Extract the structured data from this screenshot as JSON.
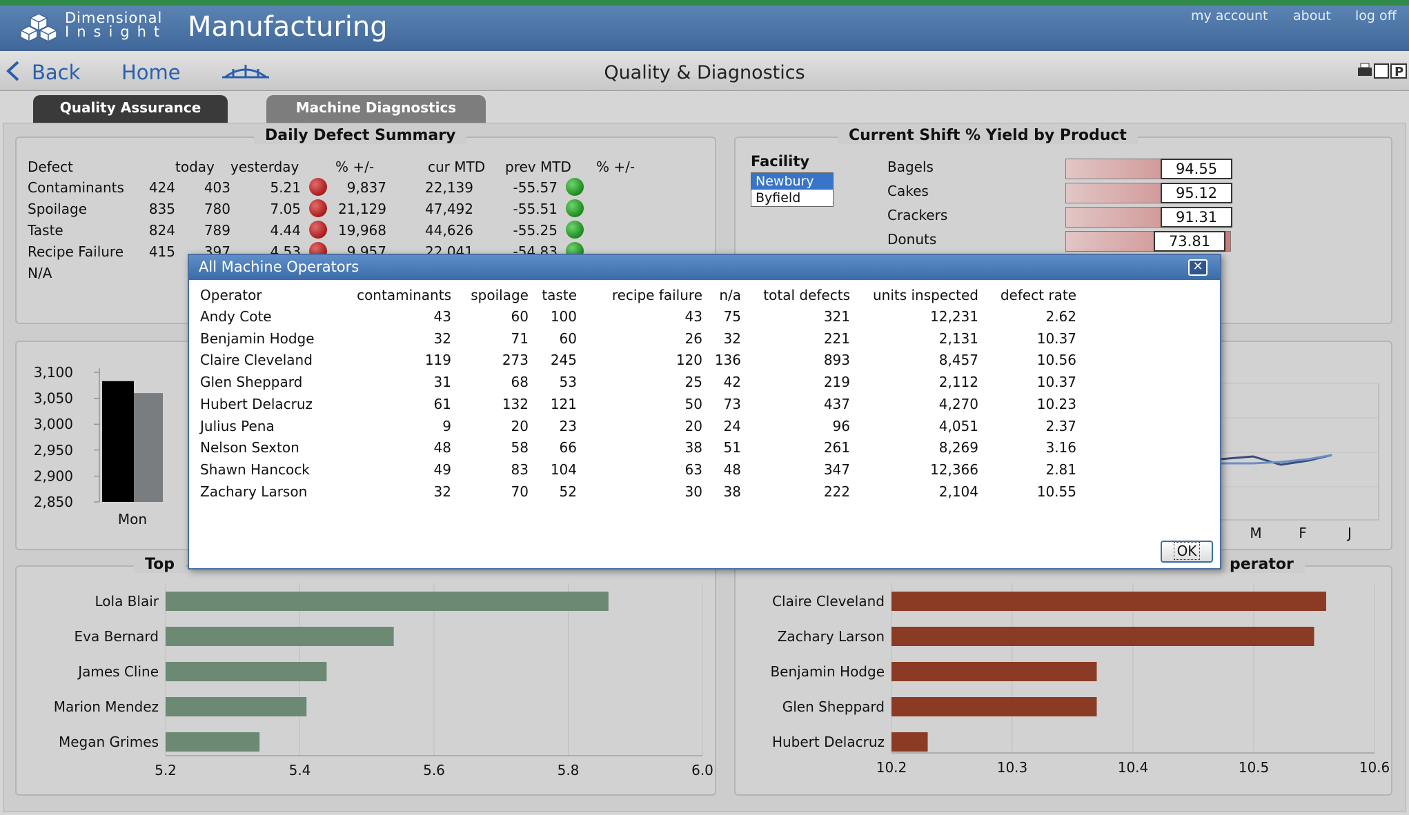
{
  "header": {
    "logo_line1": "Dimensional",
    "logo_line2": "Insight",
    "app_title": "Manufacturing",
    "links": [
      "my account",
      "about",
      "log off"
    ]
  },
  "nav": {
    "back": "Back",
    "home": "Home",
    "page_title": "Quality & Diagnostics"
  },
  "tabs": [
    "Quality Assurance",
    "Machine Diagnostics"
  ],
  "defect_summary": {
    "title": "Daily Defect Summary",
    "columns": [
      "Defect",
      "today",
      "yesterday",
      "% +/-",
      "cur MTD",
      "prev MTD",
      "% +/-"
    ],
    "rows": [
      {
        "name": "Contaminants",
        "today": "424",
        "yesterday": "403",
        "pct": "5.21",
        "cur_mtd": "9,837",
        "prev_mtd": "22,139",
        "pct2": "-55.57"
      },
      {
        "name": "Spoilage",
        "today": "835",
        "yesterday": "780",
        "pct": "7.05",
        "cur_mtd": "21,129",
        "prev_mtd": "47,492",
        "pct2": "-55.51"
      },
      {
        "name": "Taste",
        "today": "824",
        "yesterday": "789",
        "pct": "4.44",
        "cur_mtd": "19,968",
        "prev_mtd": "44,626",
        "pct2": "-55.25"
      },
      {
        "name": "Recipe Failure",
        "today": "415",
        "yesterday": "397",
        "pct": "4.53",
        "cur_mtd": "9,957",
        "prev_mtd": "22,041",
        "pct2": "-54.83"
      },
      {
        "name": "N/A",
        "today": "",
        "yesterday": "",
        "pct": "",
        "cur_mtd": "",
        "prev_mtd": "",
        "pct2": ""
      }
    ]
  },
  "yield": {
    "title": "Current Shift % Yield by Product",
    "facility_label": "Facility",
    "facilities": [
      "Newbury",
      "Byfield"
    ],
    "selected_facility": "Newbury",
    "products": [
      {
        "name": "Bagels",
        "value": "94.55"
      },
      {
        "name": "Cakes",
        "value": "95.12"
      },
      {
        "name": "Crackers",
        "value": "91.31"
      },
      {
        "name": "Donuts",
        "value": "73.81"
      }
    ]
  },
  "daily_chart": {
    "category": "Mon",
    "ticks": [
      "3,100",
      "3,050",
      "3,000",
      "2,950",
      "2,900",
      "2,850"
    ]
  },
  "trend_chart": {
    "month_ticks": [
      "M",
      "F",
      "J"
    ]
  },
  "left_bar_title": "Top",
  "right_bar_title": "perator",
  "chart_data": [
    {
      "type": "bar",
      "title": "Top",
      "orientation": "horizontal",
      "categories": [
        "Lola Blair",
        "Eva Bernard",
        "James Cline",
        "Marion Mendez",
        "Megan Grimes"
      ],
      "values": [
        5.86,
        5.54,
        5.44,
        5.41,
        5.34
      ],
      "xlim": [
        5.2,
        6.0
      ],
      "ticks": [
        "5.2",
        "5.4",
        "5.6",
        "5.8",
        "6.0"
      ],
      "color": "#6c8a73",
      "grid": true
    },
    {
      "type": "bar",
      "title": "perator",
      "orientation": "horizontal",
      "categories": [
        "Claire Cleveland",
        "Zachary Larson",
        "Benjamin Hodge",
        "Glen Sheppard",
        "Hubert Delacruz"
      ],
      "values": [
        10.56,
        10.55,
        10.37,
        10.37,
        10.23
      ],
      "xlim": [
        10.2,
        10.6
      ],
      "ticks": [
        "10.2",
        "10.3",
        "10.4",
        "10.5",
        "10.6"
      ],
      "color": "#8b3a24",
      "grid": true
    },
    {
      "type": "bar",
      "categories": [
        "Mon"
      ],
      "series": [
        {
          "values": [
            3083
          ]
        },
        {
          "values": [
            3060
          ]
        }
      ],
      "ylim": [
        2850,
        3100
      ],
      "colors": [
        "#000000",
        "#7a7d80"
      ]
    }
  ],
  "modal": {
    "title": "All Machine Operators",
    "columns": [
      "Operator",
      "contaminants",
      "spoilage",
      "taste",
      "recipe failure",
      "n/a",
      "total defects",
      "units inspected",
      "defect rate"
    ],
    "rows": [
      [
        "Andy Cote",
        "43",
        "60",
        "100",
        "43",
        "75",
        "321",
        "12,231",
        "2.62"
      ],
      [
        "Benjamin Hodge",
        "32",
        "71",
        "60",
        "26",
        "32",
        "221",
        "2,131",
        "10.37"
      ],
      [
        "Claire Cleveland",
        "119",
        "273",
        "245",
        "120",
        "136",
        "893",
        "8,457",
        "10.56"
      ],
      [
        "Glen Sheppard",
        "31",
        "68",
        "53",
        "25",
        "42",
        "219",
        "2,112",
        "10.37"
      ],
      [
        "Hubert Delacruz",
        "61",
        "132",
        "121",
        "50",
        "73",
        "437",
        "4,270",
        "10.23"
      ],
      [
        "Julius Pena",
        "9",
        "20",
        "23",
        "20",
        "24",
        "96",
        "4,051",
        "2.37"
      ],
      [
        "Nelson Sexton",
        "48",
        "58",
        "66",
        "38",
        "51",
        "261",
        "8,269",
        "3.16"
      ],
      [
        "Shawn Hancock",
        "49",
        "83",
        "104",
        "63",
        "48",
        "347",
        "12,366",
        "2.81"
      ],
      [
        "Zachary Larson",
        "32",
        "70",
        "52",
        "30",
        "38",
        "222",
        "2,104",
        "10.55"
      ]
    ],
    "ok_label": "OK"
  },
  "colors": {
    "header_blue": "#4a76aa",
    "accent_green": "#2f8a4a",
    "left_bar": "#6c8a73",
    "right_bar": "#8b3a24"
  }
}
